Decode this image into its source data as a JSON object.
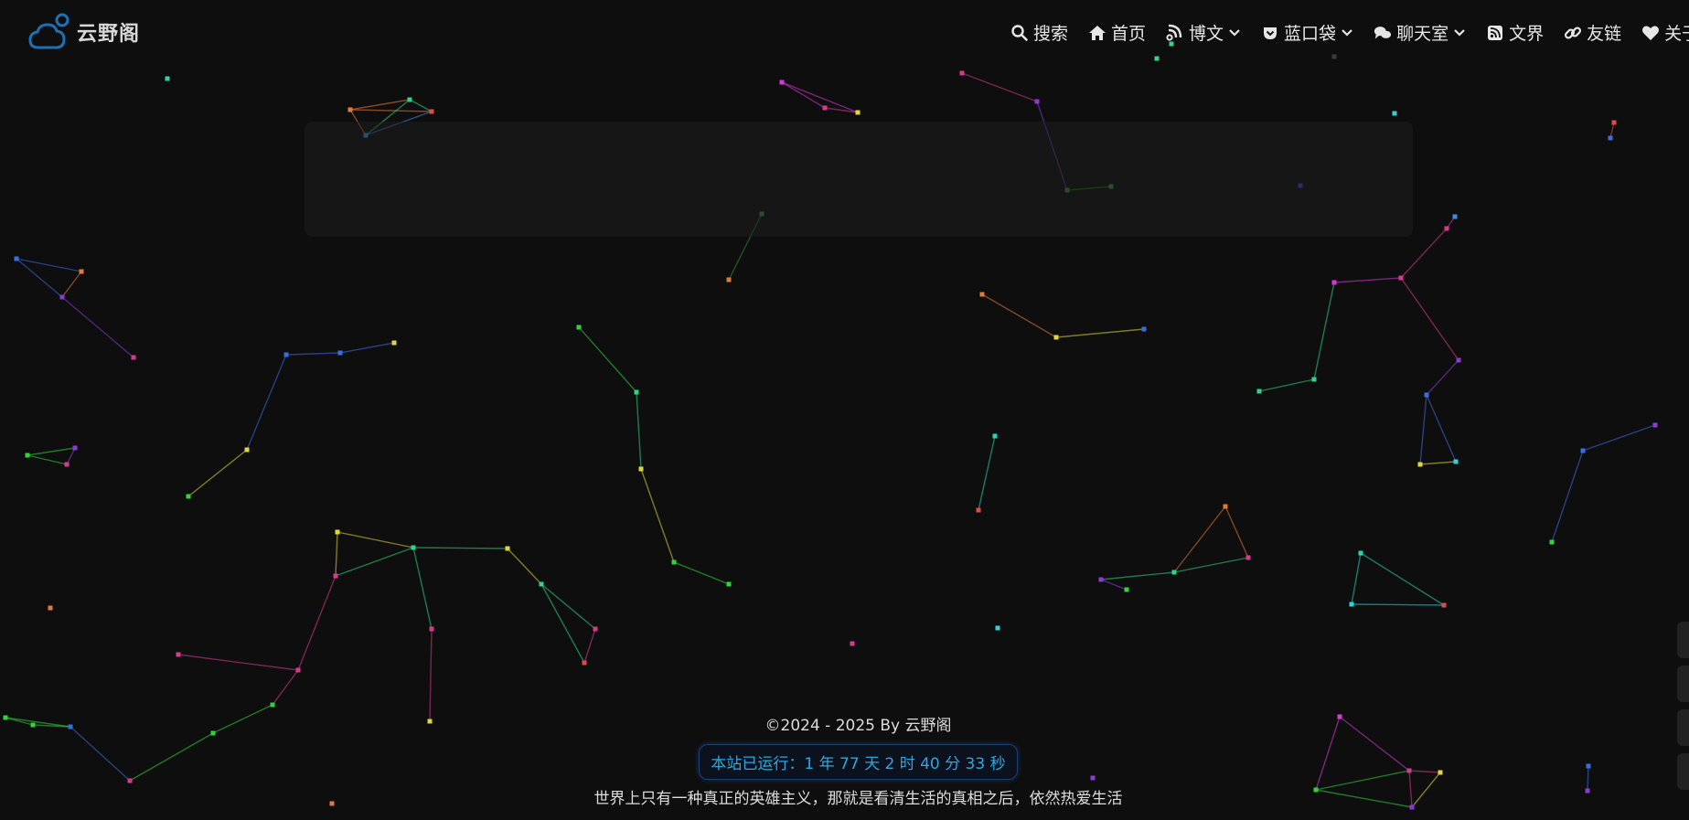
{
  "header": {
    "site_title": "云野阁",
    "nav": [
      {
        "label": "搜索",
        "icon": "search-icon",
        "has_dropdown": false
      },
      {
        "label": "首页",
        "icon": "home-icon",
        "has_dropdown": false
      },
      {
        "label": "博文",
        "icon": "blog-icon",
        "has_dropdown": true
      },
      {
        "label": "蓝口袋",
        "icon": "pocket-icon",
        "has_dropdown": true
      },
      {
        "label": "聊天室",
        "icon": "chat-icon",
        "has_dropdown": true
      },
      {
        "label": "文界",
        "icon": "rss-icon",
        "has_dropdown": false
      },
      {
        "label": "友链",
        "icon": "link-icon",
        "has_dropdown": false
      },
      {
        "label": "关于",
        "icon": "heart-icon",
        "has_dropdown": false
      }
    ]
  },
  "footer": {
    "copyright": "©2024 - 2025 By 云野阁",
    "runtime": "本站已运行：1 年 77 天 2 时 40 分 33 秒",
    "motto": "世界上只有一种真正的英雄主义，那就是看清生活的真相之后，依然热爱生活"
  },
  "colors": {
    "background": "#0e0e0e",
    "accent": "#29a9e0",
    "logo": "#1f6fb5"
  }
}
